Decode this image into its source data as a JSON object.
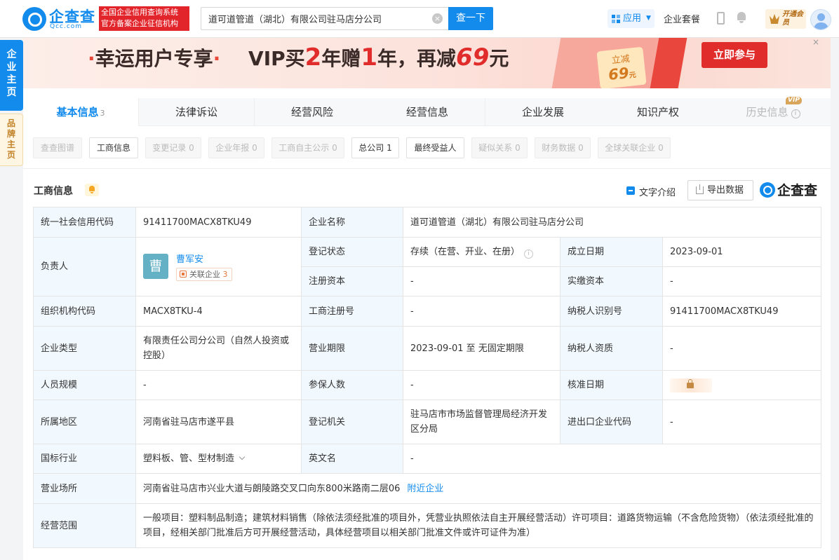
{
  "header": {
    "logo_name": "企查查",
    "logo_domain": "Qcc.com",
    "slogan_line1": "全国企业信用查询系统",
    "slogan_line2": "官方备案企业征信机构",
    "search_value": "道可道管道（湖北）有限公司驻马店分公司",
    "search_button": "查一下",
    "app_label": "应用",
    "suite_label": "企业套餐",
    "vip_open_label": "开通会员",
    "brand_color": "#128bed"
  },
  "side": {
    "main_tab": "企业主页",
    "brand_tab": "品牌主页"
  },
  "banner": {
    "dot_left": "·",
    "text1": "幸运用户专享",
    "dot_right": "·",
    "text2": "VIP买",
    "num1": "2",
    "text3": "年赠",
    "num2": "1",
    "text4": "年，再减",
    "num3": "69",
    "text5": "元",
    "coupon_label": "立减",
    "coupon_value": "69",
    "coupon_unit": "元",
    "join_button": "立即参与",
    "close": "×"
  },
  "tabs": [
    {
      "label": "基本信息",
      "count": "3"
    },
    {
      "label": "法律诉讼"
    },
    {
      "label": "经营风险"
    },
    {
      "label": "经营信息"
    },
    {
      "label": "企业发展"
    },
    {
      "label": "知识产权"
    },
    {
      "label": "历史信息",
      "badge": "VIP"
    }
  ],
  "subtabs": [
    {
      "label": "查查图谱"
    },
    {
      "label": "工商信息"
    },
    {
      "label": "变更记录 0"
    },
    {
      "label": "企业年报 0"
    },
    {
      "label": "工商自主公示 0"
    },
    {
      "label": "总公司 1"
    },
    {
      "label": "最终受益人"
    },
    {
      "label": "疑似关系 0"
    },
    {
      "label": "财务数据 0"
    },
    {
      "label": "全球关联企业 0"
    }
  ],
  "section": {
    "title": "工商信息",
    "text_intro": "文字介绍",
    "export": "导出数据",
    "mark": "企查查"
  },
  "table": {
    "uscc_k": "统一社会信用代码",
    "uscc_v": "91411700MACX8TKU49",
    "name_k": "企业名称",
    "name_v": "道可道管道（湖北）有限公司驻马店分公司",
    "leader_k": "负责人",
    "leader_avatar": "曹",
    "leader_name": "曹军安",
    "leader_rel": "关联企业",
    "leader_rel_count": "3",
    "reg_status_k": "登记状态",
    "reg_status_v": "存续（在营、开业、在册）",
    "est_date_k": "成立日期",
    "est_date_v": "2023-09-01",
    "reg_cap_k": "注册资本",
    "reg_cap_v": "-",
    "paid_cap_k": "实缴资本",
    "paid_cap_v": "-",
    "org_code_k": "组织机构代码",
    "org_code_v": "MACX8TKU-4",
    "biz_reg_no_k": "工商注册号",
    "biz_reg_no_v": "-",
    "tax_id_k": "纳税人识别号",
    "tax_id_v": "91411700MACX8TKU49",
    "type_k": "企业类型",
    "type_v": "有限责任公司分公司（自然人投资或控股）",
    "term_k": "营业期限",
    "term_v": "2023-09-01 至 无固定期限",
    "taxpayer_q_k": "纳税人资质",
    "taxpayer_q_v": "-",
    "staff_k": "人员规模",
    "staff_v": "-",
    "insured_k": "参保人数",
    "insured_v": "-",
    "approve_k": "核准日期",
    "region_k": "所属地区",
    "region_v": "河南省驻马店市遂平县",
    "authority_k": "登记机关",
    "authority_v": "驻马店市市场监督管理局经济开发区分局",
    "import_k": "进出口企业代码",
    "import_v": "-",
    "industry_k": "国标行业",
    "industry_v": "塑料板、管、型材制造",
    "en_name_k": "英文名",
    "en_name_v": "-",
    "address_k": "营业场所",
    "address_v": "河南省驻马店市兴业大道与朗陵路交叉口向东800米路南二层06",
    "nearby": "附近企业",
    "scope_k": "经营范围",
    "scope_v": "一般项目：塑料制品制造；建筑材料销售（除依法须经批准的项目外，凭营业执照依法自主开展经营活动）许可项目：道路货物运输（不含危险货物）（依法须经批准的项目，经相关部门批准后方可开展经营活动，具体经营项目以相关部门批准文件或许可证件为准）"
  }
}
